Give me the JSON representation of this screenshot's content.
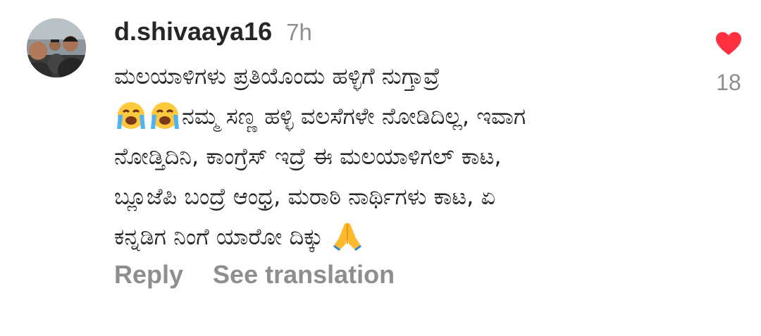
{
  "comment": {
    "username": "d.shivaaya16",
    "timestamp": "7h",
    "lines": [
      "ಮಲಯಾಳಿಗಳು ಪ್ರತಿಯೊಂದು ಹಳ್ಳಿಗೆ ನುಗ್ತಾವ್ರೆ",
      "ನಮ್ಮ ಸಣ್ಣ ಹಳ್ಳಿ ವಲಸೆಗಳೇ ನೋಡಿದಿಲ್ಲ, ಇವಾಗ",
      "ನೋಡ್ತಿದಿನಿ, ಕಾಂಗ್ರೆಸ್ ಇದ್ರೆ ಈ ಮಲಯಾಳಿಗಲ್ ಕಾಟ,",
      "ಬ್ಲೂಜೆಪಿ ಬಂದ್ರೆ ಆಂಧ್ರ, ಮರಾಠಿ ನಾರ್ಥಿಗಳು ಕಾಟ, ಏ",
      "ಕನ್ನಡಿಗ ನಿಂಗೆ ಯಾರೋ ದಿಕ್ಕು "
    ],
    "emojis": {
      "crying": "loudly-crying-face-icon",
      "folded_hands": "folded-hands-icon"
    },
    "actions": {
      "reply": "Reply",
      "translate": "See translation"
    },
    "likes": {
      "count": "18",
      "liked": true,
      "icon": "heart-icon",
      "color": "#ff3040"
    }
  },
  "colors": {
    "primary_text": "#262626",
    "secondary_text": "#8e8e8e",
    "background": "#ffffff"
  }
}
